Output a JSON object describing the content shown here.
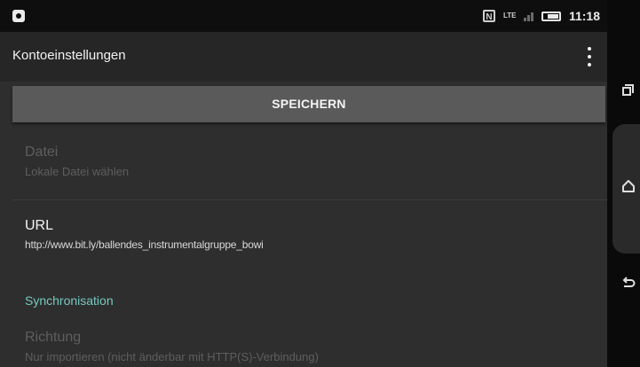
{
  "status_bar": {
    "time": "11:18",
    "nfc_label": "N",
    "lte_label": "LTE"
  },
  "app_bar": {
    "title": "Kontoeinstellungen"
  },
  "save_button": {
    "label": "SPEICHERN"
  },
  "preferences": {
    "file": {
      "title": "Datei",
      "summary": "Lokale Datei wählen",
      "enabled": false
    },
    "url": {
      "title": "URL",
      "summary": "http://www.bit.ly/ballendes_instrumentalgruppe_bowi",
      "enabled": true
    },
    "sync_header": "Synchronisation",
    "direction": {
      "title": "Richtung",
      "summary": "Nur importieren (nicht änderbar mit HTTP(S)-Verbindung)",
      "enabled": false
    }
  },
  "navigation_bar": {
    "icons": [
      "recents-icon",
      "home-icon",
      "back-icon"
    ]
  },
  "colors": {
    "accent": "#77c9c0",
    "background": "#2e2e2e",
    "button": "#5a5a5a"
  }
}
